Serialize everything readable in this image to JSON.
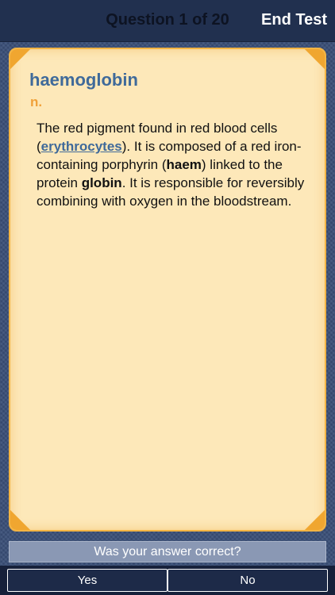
{
  "header": {
    "title": "Question 1 of 20",
    "end_label": "End Test"
  },
  "card": {
    "word": "haemoglobin",
    "part_of_speech": "n.",
    "definition": {
      "t1": "The red pigment found in red blood cells (",
      "link": "erythrocytes",
      "t2": "). It is composed of a red iron-containing porphyrin (",
      "bold1": "haem",
      "t3": ") linked to the protein ",
      "bold2": "globin",
      "t4": ". It is responsible for reversibly combining with oxygen in the bloodstream."
    }
  },
  "prompt": {
    "question": "Was your answer correct?",
    "yes_label": "Yes",
    "no_label": "No"
  },
  "colors": {
    "topbar": "#21304f",
    "card_bg": "#fde8b9",
    "card_border": "#f3b443",
    "word": "#3f6a9a",
    "part_of_speech": "#f0a13a"
  }
}
